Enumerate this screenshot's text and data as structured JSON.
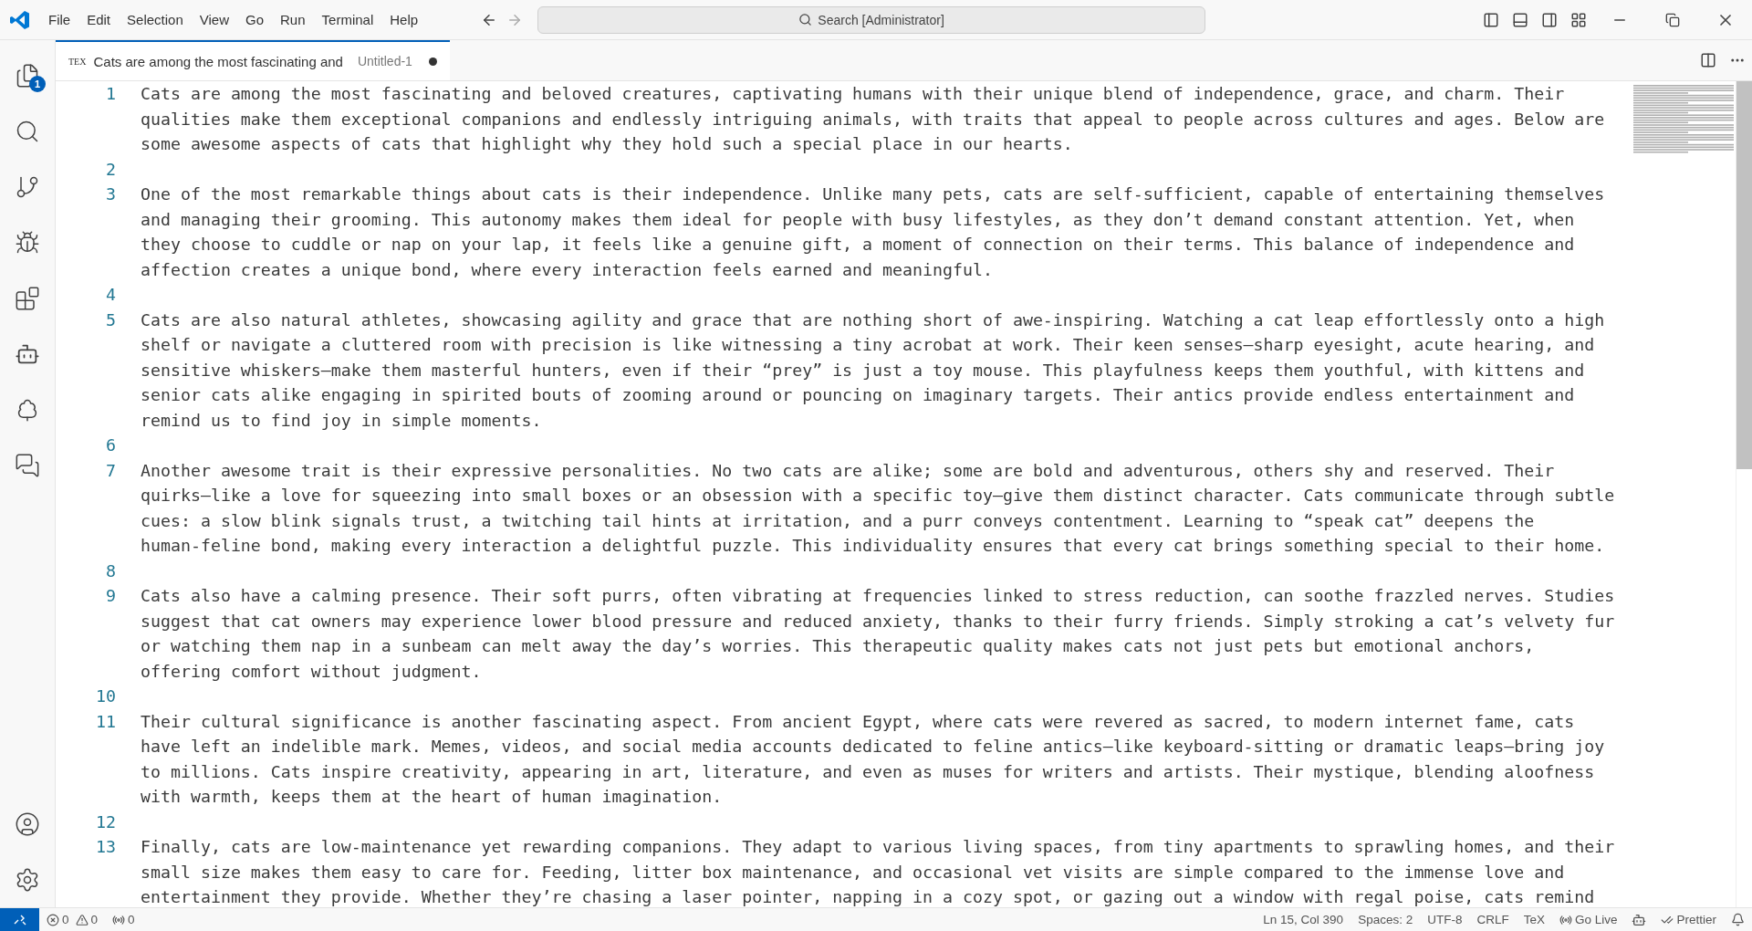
{
  "menu": [
    "File",
    "Edit",
    "Selection",
    "View",
    "Go",
    "Run",
    "Terminal",
    "Help"
  ],
  "search": {
    "placeholder": "Search [Administrator]"
  },
  "explorer_badge": "1",
  "tab": {
    "language_icon": "TEX",
    "title": "Cats are among the most fascinating and",
    "description": "Untitled-1",
    "modified": true,
    "selected": true
  },
  "editor_lines": [
    {
      "number": "1",
      "rows": [
        "Cats are among the most fascinating and beloved creatures, captivating humans with their unique blend of independence, grace, and charm. Their",
        "qualities make them exceptional companions and endlessly intriguing animals, with traits that appeal to people across cultures and ages. Below are",
        "some awesome aspects of cats that highlight why they hold such a special place in our hearts."
      ]
    },
    {
      "number": "2"
    },
    {
      "number": "3",
      "rows": [
        "One of the most remarkable things about cats is their independence. Unlike many pets, cats are self-sufficient, capable of entertaining themselves",
        "and managing their grooming. This autonomy makes them ideal for people with busy lifestyles, as they don’t demand constant attention. Yet, when",
        "they choose to cuddle or nap on your lap, it feels like a genuine gift, a moment of connection on their terms. This balance of independence and",
        "affection creates a unique bond, where every interaction feels earned and meaningful."
      ]
    },
    {
      "number": "4"
    },
    {
      "number": "5",
      "rows": [
        "Cats are also natural athletes, showcasing agility and grace that are nothing short of awe-inspiring. Watching a cat leap effortlessly onto a high",
        "shelf or navigate a cluttered room with precision is like witnessing a tiny acrobat at work. Their keen senses—sharp eyesight, acute hearing, and",
        "sensitive whiskers—make them masterful hunters, even if their “prey” is just a toy mouse. This playfulness keeps them youthful, with kittens and",
        "senior cats alike engaging in spirited bouts of zooming around or pouncing on imaginary targets. Their antics provide endless entertainment and",
        "remind us to find joy in simple moments."
      ]
    },
    {
      "number": "6"
    },
    {
      "number": "7",
      "rows": [
        "Another awesome trait is their expressive personalities. No two cats are alike; some are bold and adventurous, others shy and reserved. Their",
        "quirks—like a love for squeezing into small boxes or an obsession with a specific toy—give them distinct character. Cats communicate through subtle",
        "cues: a slow blink signals trust, a twitching tail hints at irritation, and a purr conveys contentment. Learning to “speak cat” deepens the",
        "human-feline bond, making every interaction a delightful puzzle. This individuality ensures that every cat brings something special to their home."
      ]
    },
    {
      "number": "8"
    },
    {
      "number": "9",
      "rows": [
        "Cats also have a calming presence. Their soft purrs, often vibrating at frequencies linked to stress reduction, can soothe frazzled nerves. Studies",
        "suggest that cat owners may experience lower blood pressure and reduced anxiety, thanks to their furry friends. Simply stroking a cat’s velvety fur",
        "or watching them nap in a sunbeam can melt away the day’s worries. This therapeutic quality makes cats not just pets but emotional anchors,",
        "offering comfort without judgment."
      ]
    },
    {
      "number": "10"
    },
    {
      "number": "11",
      "rows": [
        "Their cultural significance is another fascinating aspect. From ancient Egypt, where cats were revered as sacred, to modern internet fame, cats",
        "have left an indelible mark. Memes, videos, and social media accounts dedicated to feline antics—like keyboard-sitting or dramatic leaps—bring joy",
        "to millions. Cats inspire creativity, appearing in art, literature, and even as muses for writers and artists. Their mystique, blending aloofness",
        "with warmth, keeps them at the heart of human imagination."
      ]
    },
    {
      "number": "12"
    },
    {
      "number": "13",
      "rows": [
        "Finally, cats are low-maintenance yet rewarding companions. They adapt to various living spaces, from tiny apartments to sprawling homes, and their",
        "small size makes them easy to care for. Feeding, litter box maintenance, and occasional vet visits are simple compared to the immense love and",
        "entertainment they provide. Whether they’re chasing a laser pointer, napping in a cozy spot, or gazing out a window with regal poise, cats remind"
      ]
    }
  ],
  "status_bar": {
    "errors": "0",
    "warnings": "0",
    "ports": "0",
    "items": [
      "Ln 15, Col 390",
      "Spaces: 2",
      "UTF-8",
      "CRLF",
      "TeX"
    ],
    "go_live": "Go Live",
    "prettier": "Prettier"
  }
}
